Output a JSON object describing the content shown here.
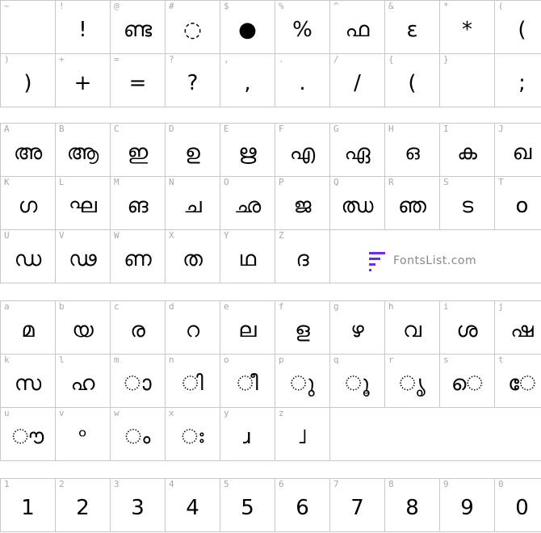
{
  "sections": [
    {
      "id": "symbols",
      "rows": [
        [
          {
            "key": "~",
            "glyph": ""
          },
          {
            "key": "!",
            "glyph": "!"
          },
          {
            "key": "@",
            "glyph": "ണ്ട"
          },
          {
            "key": "#",
            "glyph": "◌"
          },
          {
            "key": "$",
            "glyph": "●"
          },
          {
            "key": "%",
            "glyph": "%"
          },
          {
            "key": "^",
            "glyph": "ഫ"
          },
          {
            "key": "&",
            "glyph": "ε"
          },
          {
            "key": "*",
            "glyph": "*"
          },
          {
            "key": "(",
            "glyph": "("
          }
        ],
        [
          {
            "key": ")",
            "glyph": ")"
          },
          {
            "key": "+",
            "glyph": "+"
          },
          {
            "key": "=",
            "glyph": "="
          },
          {
            "key": "?",
            "glyph": "?"
          },
          {
            "key": ",",
            "glyph": ","
          },
          {
            "key": ".",
            "glyph": "."
          },
          {
            "key": "/",
            "glyph": "/"
          },
          {
            "key": "{",
            "glyph": "("
          },
          {
            "key": "}",
            "glyph": ""
          },
          {
            "key": "",
            "glyph": ";"
          }
        ]
      ]
    },
    {
      "id": "uppercase",
      "rows": [
        [
          {
            "key": "A",
            "glyph": "അ"
          },
          {
            "key": "B",
            "glyph": "ആ"
          },
          {
            "key": "C",
            "glyph": "ഇ"
          },
          {
            "key": "D",
            "glyph": "ഉ"
          },
          {
            "key": "E",
            "glyph": "ഋ"
          },
          {
            "key": "F",
            "glyph": "എ"
          },
          {
            "key": "G",
            "glyph": "ഏ"
          },
          {
            "key": "H",
            "glyph": "ഒ"
          },
          {
            "key": "I",
            "glyph": "ക"
          },
          {
            "key": "J",
            "glyph": "ഖ"
          }
        ],
        [
          {
            "key": "K",
            "glyph": "ഗ"
          },
          {
            "key": "L",
            "glyph": "ഘ"
          },
          {
            "key": "M",
            "glyph": "ങ"
          },
          {
            "key": "N",
            "glyph": "ച"
          },
          {
            "key": "O",
            "glyph": "ഛ"
          },
          {
            "key": "P",
            "glyph": "ജ"
          },
          {
            "key": "Q",
            "glyph": "ഝ"
          },
          {
            "key": "R",
            "glyph": "ഞ"
          },
          {
            "key": "S",
            "glyph": "ട"
          },
          {
            "key": "T",
            "glyph": "o"
          }
        ],
        [
          {
            "key": "U",
            "glyph": "ഡ"
          },
          {
            "key": "V",
            "glyph": "ഢ"
          },
          {
            "key": "W",
            "glyph": "ണ"
          },
          {
            "key": "X",
            "glyph": "ത"
          },
          {
            "key": "Y",
            "glyph": "ഥ"
          },
          {
            "key": "Z",
            "glyph": "ദ"
          },
          {
            "key": "",
            "glyph": ""
          },
          {
            "key": "",
            "glyph": ""
          },
          {
            "key": "",
            "glyph": ""
          },
          {
            "key": "",
            "glyph": ""
          }
        ]
      ]
    },
    {
      "id": "lowercase",
      "rows": [
        [
          {
            "key": "a",
            "glyph": "മ"
          },
          {
            "key": "b",
            "glyph": "യ"
          },
          {
            "key": "c",
            "glyph": "ര"
          },
          {
            "key": "d",
            "glyph": "റ"
          },
          {
            "key": "e",
            "glyph": "ല"
          },
          {
            "key": "f",
            "glyph": "ള"
          },
          {
            "key": "g",
            "glyph": "ഴ"
          },
          {
            "key": "h",
            "glyph": "വ"
          },
          {
            "key": "i",
            "glyph": "ശ"
          },
          {
            "key": "j",
            "glyph": "ഷ"
          }
        ],
        [
          {
            "key": "k",
            "glyph": "സ"
          },
          {
            "key": "l",
            "glyph": "ഹ"
          },
          {
            "key": "m",
            "glyph": "ാ"
          },
          {
            "key": "n",
            "glyph": "ി"
          },
          {
            "key": "o",
            "glyph": "ീ"
          },
          {
            "key": "p",
            "glyph": "ു"
          },
          {
            "key": "q",
            "glyph": "ൂ"
          },
          {
            "key": "r",
            "glyph": "ൃ"
          },
          {
            "key": "s",
            "glyph": "െ"
          },
          {
            "key": "t",
            "glyph": "േ"
          }
        ],
        [
          {
            "key": "u",
            "glyph": "ൗ"
          },
          {
            "key": "v",
            "glyph": "ᵒ"
          },
          {
            "key": "w",
            "glyph": "ം"
          },
          {
            "key": "x",
            "glyph": "ഃ"
          },
          {
            "key": "y",
            "glyph": "ɹ"
          },
          {
            "key": "z",
            "glyph": "˩"
          },
          {
            "key": "",
            "glyph": ""
          },
          {
            "key": "",
            "glyph": ""
          },
          {
            "key": "",
            "glyph": ""
          },
          {
            "key": "",
            "glyph": ""
          }
        ]
      ]
    },
    {
      "id": "digits",
      "rows": [
        [
          {
            "key": "1",
            "glyph": "1"
          },
          {
            "key": "2",
            "glyph": "2"
          },
          {
            "key": "3",
            "glyph": "3"
          },
          {
            "key": "4",
            "glyph": "4"
          },
          {
            "key": "5",
            "glyph": "5"
          },
          {
            "key": "6",
            "glyph": "6"
          },
          {
            "key": "7",
            "glyph": "7"
          },
          {
            "key": "8",
            "glyph": "8"
          },
          {
            "key": "9",
            "glyph": "9"
          },
          {
            "key": "0",
            "glyph": "0"
          }
        ]
      ]
    }
  ],
  "watermark": {
    "text": "FontsList.com",
    "icon": "fontslist-logo-icon",
    "accent_color": "#6b2ef0"
  }
}
